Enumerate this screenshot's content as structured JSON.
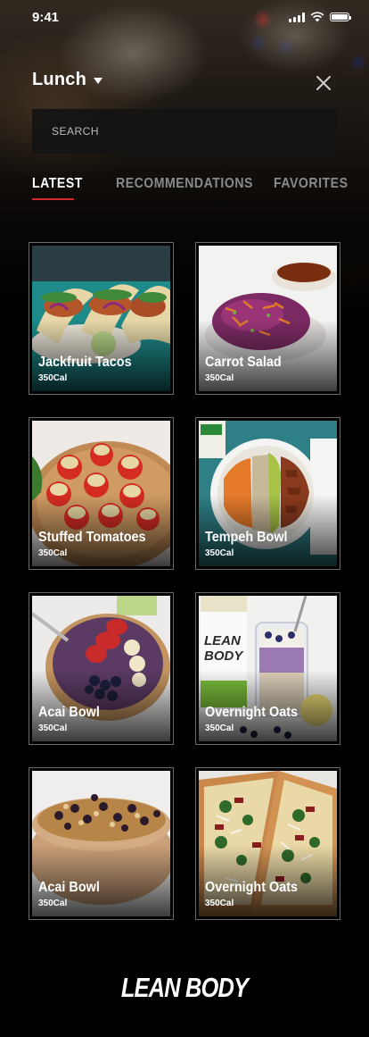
{
  "status_bar": {
    "time": "9:41"
  },
  "header": {
    "meal_label": "Lunch",
    "caret_icon": "caret-down-icon",
    "close_icon": "close-icon"
  },
  "search": {
    "placeholder": "SEARCH",
    "value": ""
  },
  "tabs": [
    {
      "label": "LATEST",
      "active": true
    },
    {
      "label": "RECOMMENDATIONS",
      "active": false
    },
    {
      "label": "FAVORITES",
      "active": false
    }
  ],
  "recipes": [
    {
      "name": "Jackfruit Tacos",
      "calories": "350Cal"
    },
    {
      "name": "Carrot Salad",
      "calories": "350Cal"
    },
    {
      "name": "Stuffed Tomatoes",
      "calories": "350Cal"
    },
    {
      "name": "Tempeh Bowl",
      "calories": "350Cal"
    },
    {
      "name": "Acai Bowl",
      "calories": "350Cal"
    },
    {
      "name": "Overnight Oats",
      "calories": "350Cal"
    },
    {
      "name": "Acai Bowl",
      "calories": "350Cal"
    },
    {
      "name": "Overnight Oats",
      "calories": "350Cal"
    }
  ],
  "brand": {
    "logo_text": "LEAN BODY"
  },
  "colors": {
    "accent": "#d22a2a",
    "background": "#000000"
  }
}
